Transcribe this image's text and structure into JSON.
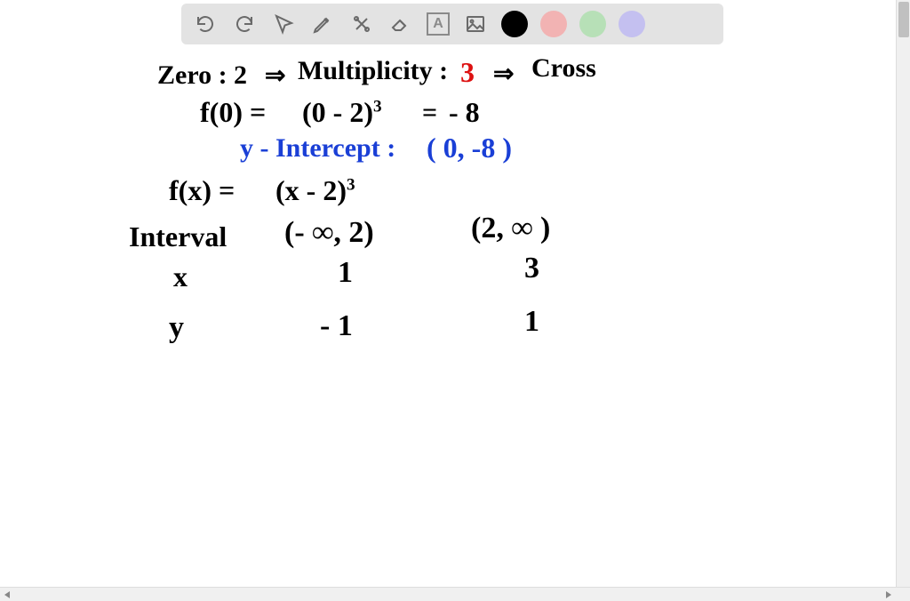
{
  "toolbar": {
    "tools": {
      "undo": "undo-icon",
      "redo": "redo-icon",
      "pointer": "pointer-icon",
      "pen": "pen-icon",
      "tools_menu": "tools-icon",
      "eraser": "eraser-icon",
      "text_box": "A",
      "image": "image-icon"
    },
    "colors": {
      "black": "#000000",
      "red": "#f2b3b3",
      "green": "#b7e0b7",
      "purple": "#c4c0f0"
    }
  },
  "notes": {
    "line1_zero_label": "Zero :",
    "line1_zero_value": "2",
    "line1_arrow1": "⇒",
    "line1_mult_label": "Multiplicity :",
    "line1_mult_value": "3",
    "line1_arrow2": "⇒",
    "line1_cross": "Cross",
    "line2_lhs": "f(0) =",
    "line2_mid": "(0 - 2)",
    "line2_exp": "3",
    "line2_eq": "=",
    "line2_rhs": "- 8",
    "line3_label": "y - Intercept :",
    "line3_value": "( 0, -8 )",
    "line4_lhs": "f(x) =",
    "line4_rhs": "(x - 2)",
    "line4_exp": "3",
    "table_header": "Interval",
    "table_col1": "(- ∞, 2)",
    "table_col2": "(2, ∞ )",
    "table_x_label": "x",
    "table_x_val1": "1",
    "table_x_val2": "3",
    "table_y_label": "y",
    "table_y_val1": "- 1",
    "table_y_val2": "1"
  }
}
